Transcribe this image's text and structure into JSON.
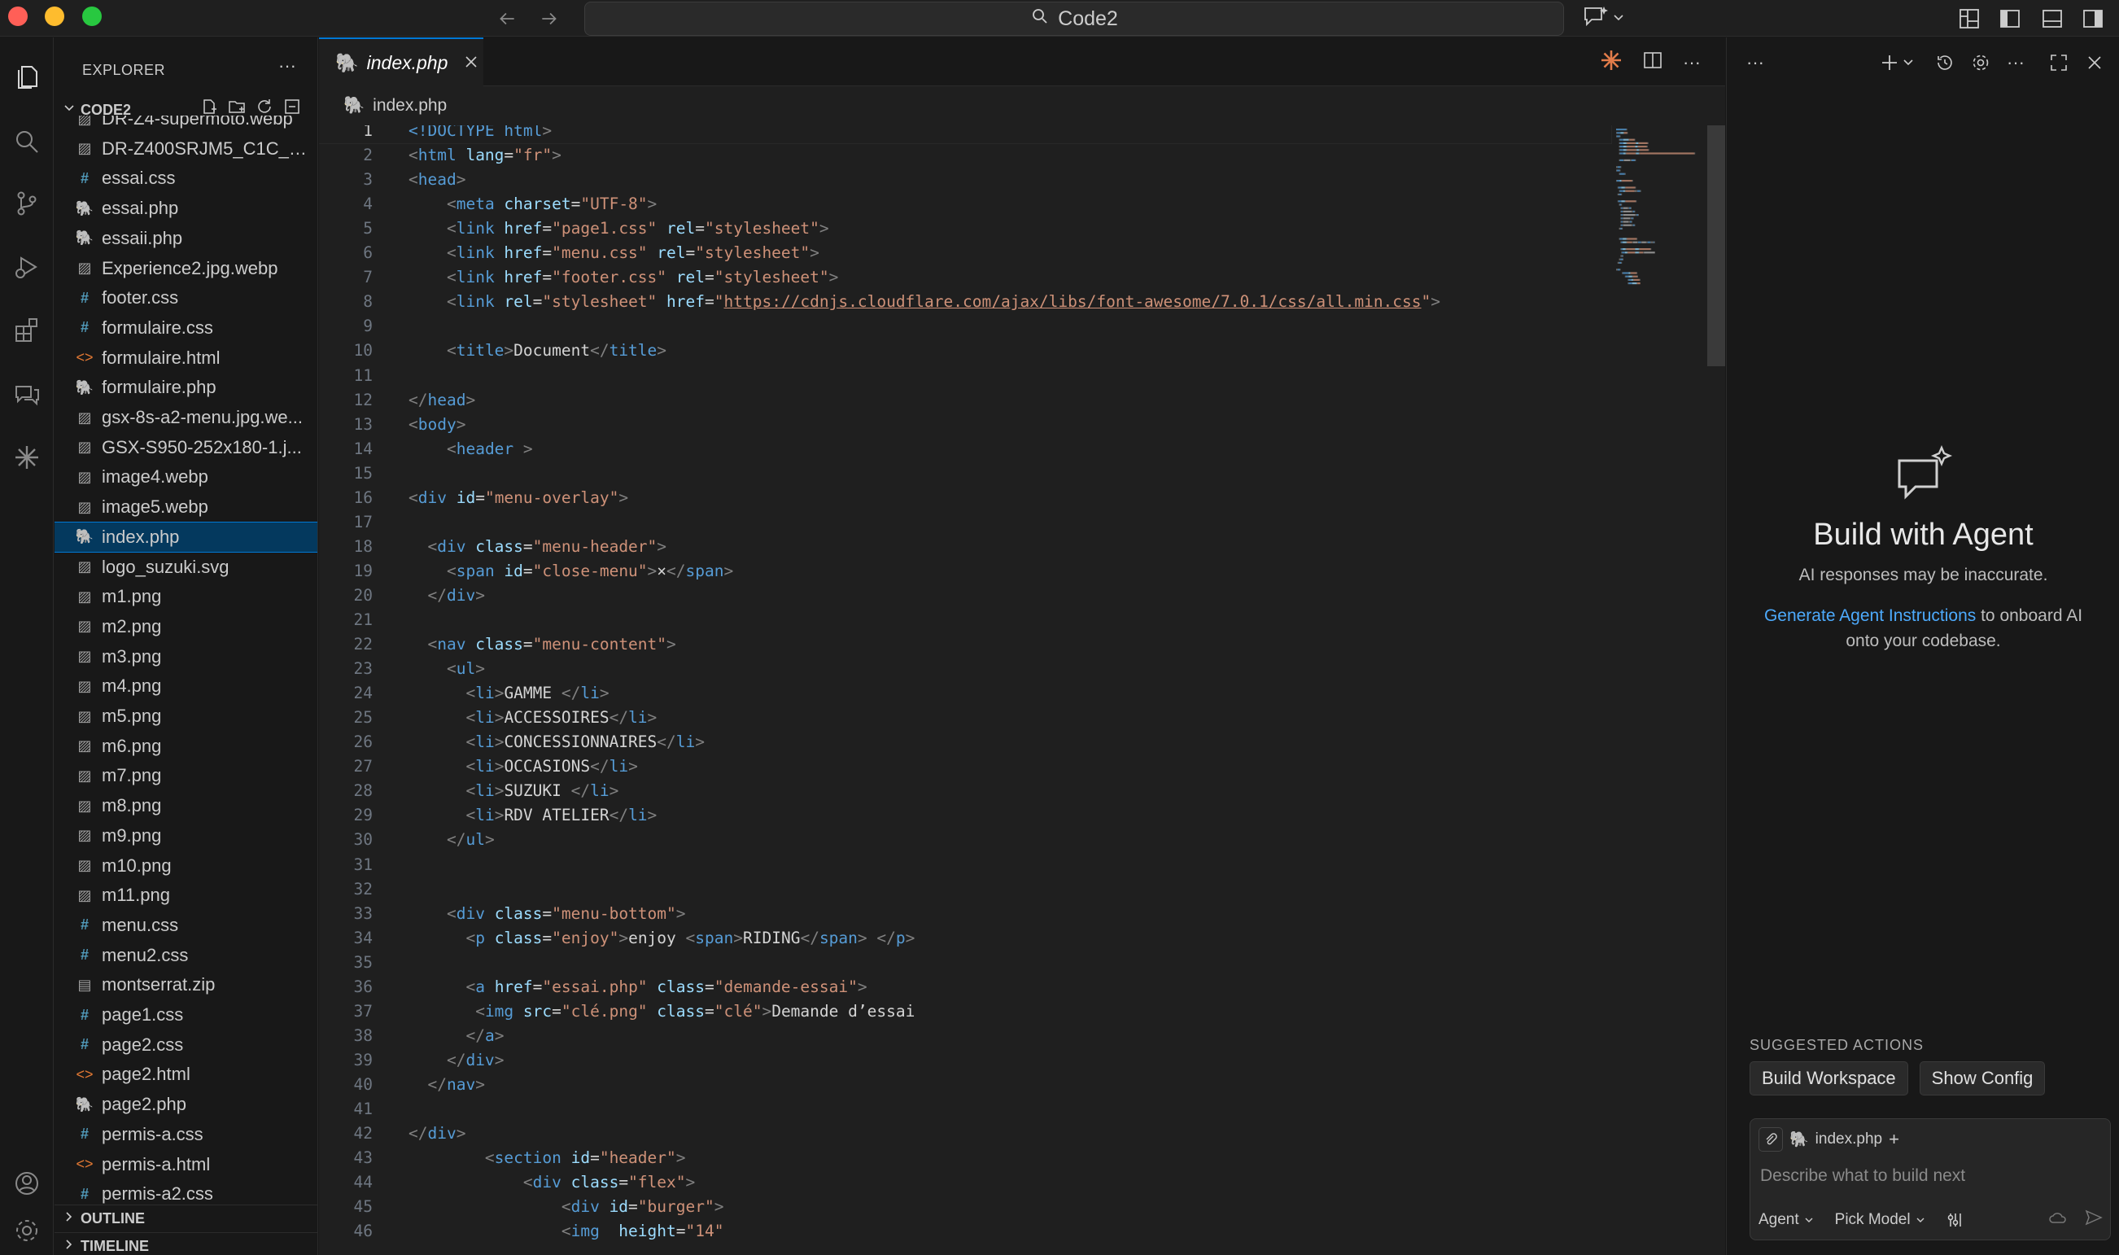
{
  "titlebar": {
    "search_text": "Code2"
  },
  "sidebar": {
    "title": "EXPLORER",
    "folder": "CODE2",
    "files": [
      {
        "name": "DR-Z4-supermoto.webp",
        "type": "img"
      },
      {
        "name": "DR-Z400SRJM5_C1C_di...",
        "type": "img"
      },
      {
        "name": "essai.css",
        "type": "css"
      },
      {
        "name": "essai.php",
        "type": "php"
      },
      {
        "name": "essaii.php",
        "type": "php"
      },
      {
        "name": "Experience2.jpg.webp",
        "type": "img"
      },
      {
        "name": "footer.css",
        "type": "css"
      },
      {
        "name": "formulaire.css",
        "type": "css"
      },
      {
        "name": "formulaire.html",
        "type": "html"
      },
      {
        "name": "formulaire.php",
        "type": "php"
      },
      {
        "name": "gsx-8s-a2-menu.jpg.we...",
        "type": "img"
      },
      {
        "name": "GSX-S950-252x180-1.j...",
        "type": "img"
      },
      {
        "name": "image4.webp",
        "type": "img"
      },
      {
        "name": "image5.webp",
        "type": "img"
      },
      {
        "name": "index.php",
        "type": "php",
        "selected": true
      },
      {
        "name": "logo_suzuki.svg",
        "type": "img"
      },
      {
        "name": "m1.png",
        "type": "img"
      },
      {
        "name": "m2.png",
        "type": "img"
      },
      {
        "name": "m3.png",
        "type": "img"
      },
      {
        "name": "m4.png",
        "type": "img"
      },
      {
        "name": "m5.png",
        "type": "img"
      },
      {
        "name": "m6.png",
        "type": "img"
      },
      {
        "name": "m7.png",
        "type": "img"
      },
      {
        "name": "m8.png",
        "type": "img"
      },
      {
        "name": "m9.png",
        "type": "img"
      },
      {
        "name": "m10.png",
        "type": "img"
      },
      {
        "name": "m11.png",
        "type": "img"
      },
      {
        "name": "menu.css",
        "type": "css"
      },
      {
        "name": "menu2.css",
        "type": "css"
      },
      {
        "name": "montserrat.zip",
        "type": "zip"
      },
      {
        "name": "page1.css",
        "type": "css"
      },
      {
        "name": "page2.css",
        "type": "css"
      },
      {
        "name": "page2.html",
        "type": "html"
      },
      {
        "name": "page2.php",
        "type": "php"
      },
      {
        "name": "permis-a.css",
        "type": "css"
      },
      {
        "name": "permis-a.html",
        "type": "html"
      },
      {
        "name": "permis-a2.css",
        "type": "css"
      }
    ],
    "outline_label": "OUTLINE",
    "timeline_label": "TIMELINE"
  },
  "editor": {
    "tab_label": "index.php",
    "breadcrumb": "index.php",
    "active_line": 1,
    "lines": [
      [
        [
          "doc",
          "<!DOCTYPE "
        ],
        [
          "tag",
          "html"
        ],
        [
          "br",
          ">"
        ]
      ],
      [
        [
          "br",
          "<"
        ],
        [
          "tag",
          "html "
        ],
        [
          "attr",
          "lang"
        ],
        [
          "txt",
          "="
        ],
        [
          "str",
          "\"fr\""
        ],
        [
          "br",
          ">"
        ]
      ],
      [
        [
          "br",
          "<"
        ],
        [
          "tag",
          "head"
        ],
        [
          "br",
          ">"
        ]
      ],
      [
        [
          "txt",
          "    "
        ],
        [
          "br",
          "<"
        ],
        [
          "tag",
          "meta "
        ],
        [
          "attr",
          "charset"
        ],
        [
          "txt",
          "="
        ],
        [
          "str",
          "\"UTF-8\""
        ],
        [
          "br",
          ">"
        ]
      ],
      [
        [
          "txt",
          "    "
        ],
        [
          "br",
          "<"
        ],
        [
          "tag",
          "link "
        ],
        [
          "attr",
          "href"
        ],
        [
          "txt",
          "="
        ],
        [
          "str",
          "\"page1.css\" "
        ],
        [
          "attr",
          "rel"
        ],
        [
          "txt",
          "="
        ],
        [
          "str",
          "\"stylesheet\""
        ],
        [
          "br",
          ">"
        ]
      ],
      [
        [
          "txt",
          "    "
        ],
        [
          "br",
          "<"
        ],
        [
          "tag",
          "link "
        ],
        [
          "attr",
          "href"
        ],
        [
          "txt",
          "="
        ],
        [
          "str",
          "\"menu.css\" "
        ],
        [
          "attr",
          "rel"
        ],
        [
          "txt",
          "="
        ],
        [
          "str",
          "\"stylesheet\""
        ],
        [
          "br",
          ">"
        ]
      ],
      [
        [
          "txt",
          "    "
        ],
        [
          "br",
          "<"
        ],
        [
          "tag",
          "link "
        ],
        [
          "attr",
          "href"
        ],
        [
          "txt",
          "="
        ],
        [
          "str",
          "\"footer.css\" "
        ],
        [
          "attr",
          "rel"
        ],
        [
          "txt",
          "="
        ],
        [
          "str",
          "\"stylesheet\""
        ],
        [
          "br",
          ">"
        ]
      ],
      [
        [
          "txt",
          "    "
        ],
        [
          "br",
          "<"
        ],
        [
          "tag",
          "link "
        ],
        [
          "attr",
          "rel"
        ],
        [
          "txt",
          "="
        ],
        [
          "str",
          "\"stylesheet\" "
        ],
        [
          "attr",
          "href"
        ],
        [
          "txt",
          "="
        ],
        [
          "str",
          "\""
        ],
        [
          "url",
          "https://cdnjs.cloudflare.com/ajax/libs/font-awesome/7.0.1/css/all.min.css"
        ],
        [
          "str",
          "\""
        ],
        [
          "br",
          ">"
        ]
      ],
      [],
      [
        [
          "txt",
          "    "
        ],
        [
          "br",
          "<"
        ],
        [
          "tag",
          "title"
        ],
        [
          "br",
          ">"
        ],
        [
          "txt",
          "Document"
        ],
        [
          "br",
          "</"
        ],
        [
          "tag",
          "title"
        ],
        [
          "br",
          ">"
        ]
      ],
      [],
      [
        [
          "br",
          "</"
        ],
        [
          "tag",
          "head"
        ],
        [
          "br",
          ">"
        ]
      ],
      [
        [
          "br",
          "<"
        ],
        [
          "tag",
          "body"
        ],
        [
          "br",
          ">"
        ]
      ],
      [
        [
          "txt",
          "    "
        ],
        [
          "br",
          "<"
        ],
        [
          "tag",
          "header "
        ],
        [
          "br",
          ">"
        ]
      ],
      [],
      [
        [
          "br",
          "<"
        ],
        [
          "tag",
          "div "
        ],
        [
          "attr",
          "id"
        ],
        [
          "txt",
          "="
        ],
        [
          "str",
          "\"menu-overlay\""
        ],
        [
          "br",
          ">"
        ]
      ],
      [],
      [
        [
          "txt",
          "  "
        ],
        [
          "br",
          "<"
        ],
        [
          "tag",
          "div "
        ],
        [
          "attr",
          "class"
        ],
        [
          "txt",
          "="
        ],
        [
          "str",
          "\"menu-header\""
        ],
        [
          "br",
          ">"
        ]
      ],
      [
        [
          "txt",
          "    "
        ],
        [
          "br",
          "<"
        ],
        [
          "tag",
          "span "
        ],
        [
          "attr",
          "id"
        ],
        [
          "txt",
          "="
        ],
        [
          "str",
          "\"close-menu\""
        ],
        [
          "br",
          ">"
        ],
        [
          "txt",
          "×"
        ],
        [
          "br",
          "</"
        ],
        [
          "tag",
          "span"
        ],
        [
          "br",
          ">"
        ]
      ],
      [
        [
          "txt",
          "  "
        ],
        [
          "br",
          "</"
        ],
        [
          "tag",
          "div"
        ],
        [
          "br",
          ">"
        ]
      ],
      [],
      [
        [
          "txt",
          "  "
        ],
        [
          "br",
          "<"
        ],
        [
          "tag",
          "nav "
        ],
        [
          "attr",
          "class"
        ],
        [
          "txt",
          "="
        ],
        [
          "str",
          "\"menu-content\""
        ],
        [
          "br",
          ">"
        ]
      ],
      [
        [
          "txt",
          "    "
        ],
        [
          "br",
          "<"
        ],
        [
          "tag",
          "ul"
        ],
        [
          "br",
          ">"
        ]
      ],
      [
        [
          "txt",
          "      "
        ],
        [
          "br",
          "<"
        ],
        [
          "tag",
          "li"
        ],
        [
          "br",
          ">"
        ],
        [
          "txt",
          "GAMME "
        ],
        [
          "br",
          "</"
        ],
        [
          "tag",
          "li"
        ],
        [
          "br",
          ">"
        ]
      ],
      [
        [
          "txt",
          "      "
        ],
        [
          "br",
          "<"
        ],
        [
          "tag",
          "li"
        ],
        [
          "br",
          ">"
        ],
        [
          "txt",
          "ACCESSOIRES"
        ],
        [
          "br",
          "</"
        ],
        [
          "tag",
          "li"
        ],
        [
          "br",
          ">"
        ]
      ],
      [
        [
          "txt",
          "      "
        ],
        [
          "br",
          "<"
        ],
        [
          "tag",
          "li"
        ],
        [
          "br",
          ">"
        ],
        [
          "txt",
          "CONCESSIONNAIRES"
        ],
        [
          "br",
          "</"
        ],
        [
          "tag",
          "li"
        ],
        [
          "br",
          ">"
        ]
      ],
      [
        [
          "txt",
          "      "
        ],
        [
          "br",
          "<"
        ],
        [
          "tag",
          "li"
        ],
        [
          "br",
          ">"
        ],
        [
          "txt",
          "OCCASIONS"
        ],
        [
          "br",
          "</"
        ],
        [
          "tag",
          "li"
        ],
        [
          "br",
          ">"
        ]
      ],
      [
        [
          "txt",
          "      "
        ],
        [
          "br",
          "<"
        ],
        [
          "tag",
          "li"
        ],
        [
          "br",
          ">"
        ],
        [
          "txt",
          "SUZUKI "
        ],
        [
          "br",
          "</"
        ],
        [
          "tag",
          "li"
        ],
        [
          "br",
          ">"
        ]
      ],
      [
        [
          "txt",
          "      "
        ],
        [
          "br",
          "<"
        ],
        [
          "tag",
          "li"
        ],
        [
          "br",
          ">"
        ],
        [
          "txt",
          "RDV ATELIER"
        ],
        [
          "br",
          "</"
        ],
        [
          "tag",
          "li"
        ],
        [
          "br",
          ">"
        ]
      ],
      [
        [
          "txt",
          "    "
        ],
        [
          "br",
          "</"
        ],
        [
          "tag",
          "ul"
        ],
        [
          "br",
          ">"
        ]
      ],
      [],
      [],
      [
        [
          "txt",
          "    "
        ],
        [
          "br",
          "<"
        ],
        [
          "tag",
          "div "
        ],
        [
          "attr",
          "class"
        ],
        [
          "txt",
          "="
        ],
        [
          "str",
          "\"menu-bottom\""
        ],
        [
          "br",
          ">"
        ]
      ],
      [
        [
          "txt",
          "      "
        ],
        [
          "br",
          "<"
        ],
        [
          "tag",
          "p "
        ],
        [
          "attr",
          "class"
        ],
        [
          "txt",
          "="
        ],
        [
          "str",
          "\"enjoy\""
        ],
        [
          "br",
          ">"
        ],
        [
          "txt",
          "enjoy "
        ],
        [
          "br",
          "<"
        ],
        [
          "tag",
          "span"
        ],
        [
          "br",
          ">"
        ],
        [
          "txt",
          "RIDING"
        ],
        [
          "br",
          "</"
        ],
        [
          "tag",
          "span"
        ],
        [
          "br",
          "> </"
        ],
        [
          "tag",
          "p"
        ],
        [
          "br",
          ">"
        ]
      ],
      [],
      [
        [
          "txt",
          "      "
        ],
        [
          "br",
          "<"
        ],
        [
          "tag",
          "a "
        ],
        [
          "attr",
          "href"
        ],
        [
          "txt",
          "="
        ],
        [
          "str",
          "\"essai.php\" "
        ],
        [
          "attr",
          "class"
        ],
        [
          "txt",
          "="
        ],
        [
          "str",
          "\"demande-essai\""
        ],
        [
          "br",
          ">"
        ]
      ],
      [
        [
          "txt",
          "       "
        ],
        [
          "br",
          "<"
        ],
        [
          "tag",
          "img "
        ],
        [
          "attr",
          "src"
        ],
        [
          "txt",
          "="
        ],
        [
          "str",
          "\"clé.png\" "
        ],
        [
          "attr",
          "class"
        ],
        [
          "txt",
          "="
        ],
        [
          "str",
          "\"clé\""
        ],
        [
          "br",
          ">"
        ],
        [
          "txt",
          "Demande d’essai"
        ]
      ],
      [
        [
          "txt",
          "      "
        ],
        [
          "br",
          "</"
        ],
        [
          "tag",
          "a"
        ],
        [
          "br",
          ">"
        ]
      ],
      [
        [
          "txt",
          "    "
        ],
        [
          "br",
          "</"
        ],
        [
          "tag",
          "div"
        ],
        [
          "br",
          ">"
        ]
      ],
      [
        [
          "txt",
          "  "
        ],
        [
          "br",
          "</"
        ],
        [
          "tag",
          "nav"
        ],
        [
          "br",
          ">"
        ]
      ],
      [],
      [
        [
          "br",
          "</"
        ],
        [
          "tag",
          "div"
        ],
        [
          "br",
          ">"
        ]
      ],
      [
        [
          "txt",
          "        "
        ],
        [
          "br",
          "<"
        ],
        [
          "tag",
          "section "
        ],
        [
          "attr",
          "id"
        ],
        [
          "txt",
          "="
        ],
        [
          "str",
          "\"header\""
        ],
        [
          "br",
          ">"
        ]
      ],
      [
        [
          "txt",
          "            "
        ],
        [
          "br",
          "<"
        ],
        [
          "tag",
          "div "
        ],
        [
          "attr",
          "class"
        ],
        [
          "txt",
          "="
        ],
        [
          "str",
          "\"flex\""
        ],
        [
          "br",
          ">"
        ]
      ],
      [
        [
          "txt",
          "                "
        ],
        [
          "br",
          "<"
        ],
        [
          "tag",
          "div "
        ],
        [
          "attr",
          "id"
        ],
        [
          "txt",
          "="
        ],
        [
          "str",
          "\"burger\""
        ],
        [
          "br",
          ">"
        ]
      ],
      [
        [
          "txt",
          "                "
        ],
        [
          "br",
          "<"
        ],
        [
          "tag",
          "img  "
        ],
        [
          "attr",
          "height"
        ],
        [
          "txt",
          "="
        ],
        [
          "str",
          "\"14\""
        ]
      ]
    ]
  },
  "agent": {
    "title": "Build with Agent",
    "subtitle": "AI responses may be inaccurate.",
    "onboard_link": "Generate Agent Instructions",
    "onboard_rest": " to onboard AI onto your codebase.",
    "suggested_label": "SUGGESTED ACTIONS",
    "suggested": [
      "Build Workspace",
      "Show Config"
    ],
    "context_file": "index.php",
    "placeholder": "Describe what to build next",
    "mode": "Agent",
    "model": "Pick Model"
  }
}
